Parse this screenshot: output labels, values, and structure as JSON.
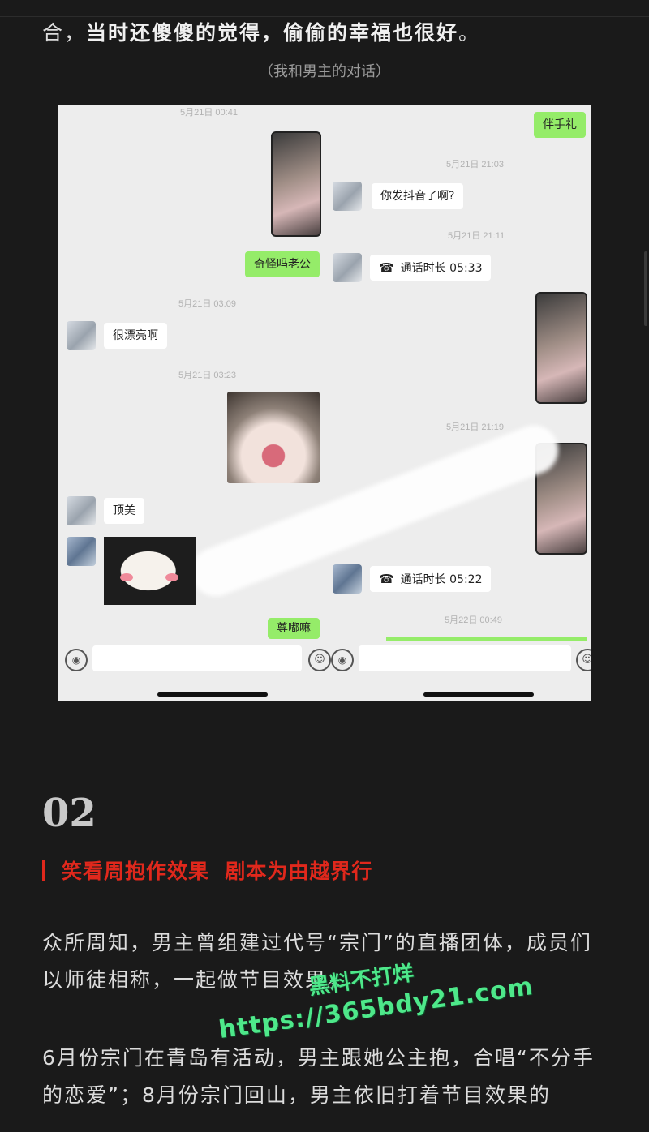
{
  "article": {
    "lead_prefix": "合，",
    "lead_bold": "当时还傻傻的觉得，偷偷的幸福也很好",
    "lead_suffix": "。",
    "caption": "（我和男主的对话）"
  },
  "chat_screenshot": {
    "timestamps": [
      "5月21日 00:41",
      "5月21日 21:03",
      "5月21日 21:11",
      "5月21日 03:09",
      "5月21日 03:23",
      "5月21日 21:19",
      "5月22日 00:49"
    ],
    "messages": [
      {
        "text": "伴手礼",
        "side": "right",
        "color": "green"
      },
      {
        "text": "你发抖音了啊?",
        "side": "left",
        "color": "white"
      },
      {
        "text": "奇怪吗老公",
        "side": "right",
        "color": "green"
      },
      {
        "text": "通话时长 05:33",
        "side": "left",
        "color": "white"
      },
      {
        "text": "很漂亮啊",
        "side": "left",
        "color": "white"
      },
      {
        "text": "顶美",
        "side": "left",
        "color": "white"
      },
      {
        "text": "通话时长 05:22",
        "side": "left",
        "color": "white"
      },
      {
        "text": "尊嘟嘛",
        "side": "right",
        "color": "green"
      }
    ],
    "call_icon": "phone-icon",
    "voice_icon": "voice-icon",
    "emoji_icon": "emoji-icon",
    "colors": {
      "green_bubble": "#95ec69",
      "chat_bg": "#ededed"
    }
  },
  "section": {
    "number": "02",
    "title": "笑看周抱作效果  剧本为由越界行",
    "accent": "#e0281c"
  },
  "paragraphs": [
    "众所周知，男主曾组建过代号“宗门”的直播团体，成员们以师徒相称，一起做节目效果。",
    "6月份宗门在青岛有活动，男主跟她公主抱，合唱“不分手的恋爱”；8月份宗门回山，男主依旧打着节目效果的"
  ],
  "watermark": {
    "line1": "黑料不打烊",
    "line2": "https://365bdy21.com",
    "color": "#4ee88a"
  }
}
